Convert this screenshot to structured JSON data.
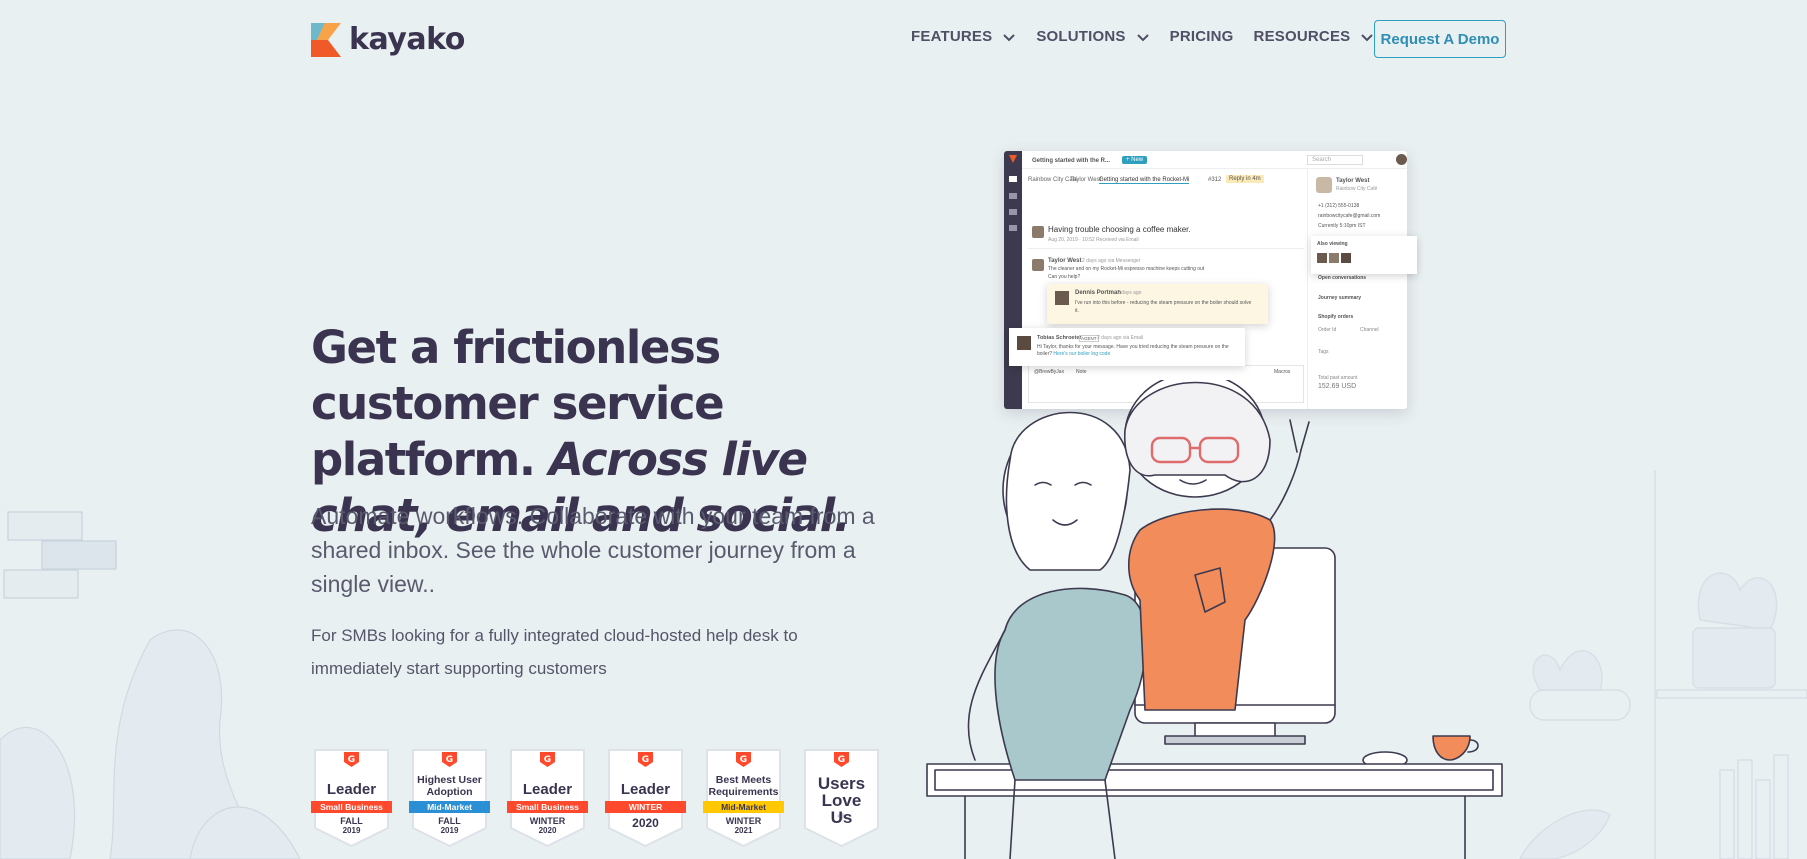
{
  "brand": {
    "name": "kayako"
  },
  "nav": {
    "items": [
      {
        "label": "FEATURES",
        "has_dropdown": true
      },
      {
        "label": "SOLUTIONS",
        "has_dropdown": true
      },
      {
        "label": "PRICING",
        "has_dropdown": false
      },
      {
        "label": "RESOURCES",
        "has_dropdown": true
      }
    ],
    "cta": "Request A Demo"
  },
  "hero": {
    "title_plain": "Get a frictionless customer service platform.",
    "title_italic": "Across live chat, email and social.",
    "subtitle": "Automate workflows. Collaborate with your team from a shared inbox. See the whole customer journey from a single view..",
    "note": "For SMBs looking for a fully integrated cloud-hosted help desk to immediately start supporting customers"
  },
  "badges": [
    {
      "title": "Leader",
      "band": "Small Business",
      "season": "FALL",
      "year": "2019",
      "band_color": "#ff492c"
    },
    {
      "title": "Highest User Adoption",
      "band": "Mid-Market",
      "season": "FALL",
      "year": "2019",
      "band_color": "#2b8fd6"
    },
    {
      "title": "Leader",
      "band": "Small Business",
      "season": "WINTER",
      "year": "2020",
      "band_color": "#ff492c"
    },
    {
      "title": "Leader",
      "band": "WINTER",
      "season": "2020",
      "year": "",
      "band_color": "#ff492c"
    },
    {
      "title": "Best Meets Requirements",
      "band": "Mid-Market",
      "season": "WINTER",
      "year": "2021",
      "band_color": "#ffc800"
    },
    {
      "title": "Users Love Us",
      "band": "",
      "season": "",
      "year": "",
      "band_color": ""
    }
  ],
  "app_preview": {
    "tab_title": "Getting started with the R...",
    "new_label": "+ New",
    "search_placeholder": "Search",
    "breadcrumb": [
      "Rainbow City Café",
      "Taylor West",
      "Getting started with the Rocket-Mi"
    ],
    "ticket_id": "#312",
    "reply_status": "Reply in 4m",
    "subject": "Having trouble choosing a coffee maker.",
    "subject_meta": "Aug 20, 2019 · 10:52 Received via Email",
    "message_author": "Taylor West",
    "message_time": "2 days ago via Messenger",
    "message_body": "The cleaner and on my Rocket-Mi espresso machine keeps cutting out",
    "message_body_2": "Can you help?",
    "note_author": "Dennis Portman",
    "note_time": "2 days ago",
    "note_body": "I've run into this before - reducing the steam pressure on the boiler should solve it.",
    "reply_author": "Tobias Schroeter",
    "reply_agent_tag": "AGENT",
    "reply_time": "2 days ago via Email",
    "reply_body": "Hi Taylor, thanks for your message. Have you tried reducing the steam pressure on the boiler?",
    "reply_link": "Here's our boiler log code",
    "composer_handle": "@BrewByJax",
    "composer_note": "Note",
    "composer_macros": "Macros",
    "customer_name": "Taylor West",
    "customer_org": "Rainbow City Café",
    "customer_phone": "+1 (312) 555-0138",
    "customer_email": "rainbowcitycafe@gmail.com",
    "customer_time": "Currently 5:10pm IST",
    "also_viewing": "Also viewing",
    "open_conversations": "Open conversations",
    "journey_summary": "Journey summary",
    "shopify_orders": "Shopify orders",
    "order_id_label": "Order Id",
    "order_channel_label": "Channel",
    "tags_label": "Tags",
    "total_spend_label": "Total past amount",
    "total_spend": "152.69 USD"
  }
}
